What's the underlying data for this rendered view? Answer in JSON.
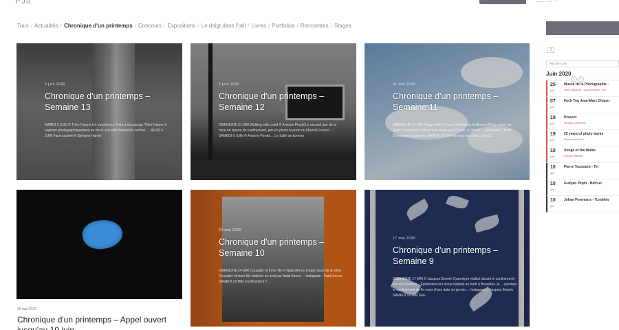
{
  "header": {
    "brand": "PJa",
    "right_text": "……… ∙ ∙"
  },
  "breadcrumb": [
    {
      "label": "Tous",
      "active": false
    },
    {
      "label": "Actualités",
      "active": false
    },
    {
      "label": "Chronique d'un printemps",
      "active": true
    },
    {
      "label": "Concours",
      "active": false
    },
    {
      "label": "Expositions",
      "active": false
    },
    {
      "label": "Le doigt dans l'œil",
      "active": false
    },
    {
      "label": "Livres",
      "active": false
    },
    {
      "label": "Portfolios",
      "active": false
    },
    {
      "label": "Rencontres",
      "active": false
    },
    {
      "label": "Stages",
      "active": false
    }
  ],
  "cards": {
    "c1": {
      "date": "9 juin 2020",
      "title": "Chronique d'un printemps – Semaine 13",
      "excerpt": "MARDI 9 JUIN © Théo Fatone Un travail pour Théo a encourage Théo Fatone à explorer photographiquement sa vie et son état d'esprit de confiné ... JEUDI 4 JUIN Face cachée © Sylvaine Hamel"
    },
    "c2": {
      "date": "2 juin 2020",
      "title": "Chronique d'un printemps – Semaine 12",
      "excerpt": "DIMANCHE 31 MAI Walking with covid © Antoine Pinold Le second jour de la mise en œuvre de confinement, pris en photo la porte du Marché Franco ... SAMEDI 6 JUIN © Antoine Pinold ... Le Salle de bonnes"
    },
    "c3": {
      "date": "31 mai 2020",
      "title": "Chronique d'un printemps – Semaine 11",
      "excerpt": "DIMANCHE 31 MAI A day in life © Jean-Christophe Guillaume Photo prise par Jean-Christophe Guillaume le week-end 12 mai, à Namur ... Instagram : Jean-Christophe Guillaume SAMEDI 30 MAI life was less than 1 me 3..."
    },
    "c4": {
      "date": "25 mai 2020",
      "title": "Chronique d'un printemps – Appel ouvert jusqu'au 19 juin"
    },
    "c5": {
      "date": "24 mai 2020",
      "title": "Chronique d'un printemps – Semaine 10",
      "excerpt": "DIMANCHE 24 MAI Crusader of Inner life © Nabil Annes Image issue de la série Crusader of inner life réalisée en avril par Nabil Annes ... Instagram : Nabil Annes SAMEDI 23 MAI Confinement T..."
    },
    "c6": {
      "date": "17 mai 2020",
      "title": "Chronique d'un printemps – Semaine 9",
      "excerpt": "DIMANCHE 17 MAI © Jacques Bonnie Cyanotype réalisé durant le confinement sur nos camées – Éphémère lors d'une ballade en forêt à Bruxelles Je ... pendant le confinement de fin mars d'une date en janvier ... Instagram : Jacques Bonnie SAMEDI 16 MAI Sea..."
    }
  },
  "sidebar": {
    "mini_label": "1",
    "search_placeholder": "Rechercher",
    "month": "Juin 2020",
    "prev_label": "‹",
    "next_label": "›",
    "events": [
      {
        "day": "25",
        "mon": "juin",
        "title": "Musée de la Photographie -",
        "sub": "René Magritte - Laurent Bilon - Bé",
        "dark": false
      },
      {
        "day": "07",
        "mon": "juin",
        "title": "Fuck You Jean-Marc Chapa -",
        "sub": "",
        "dark": false
      },
      {
        "day": "19",
        "mon": "juin",
        "title": "Present",
        "sub": "Nicolas Castlenov",
        "dark": false
      },
      {
        "day": "19",
        "mon": "juin",
        "title": "25 years of photo works",
        "sub": "Raymond Rosso",
        "dark": false
      },
      {
        "day": "19",
        "mon": "juin",
        "title": "Songs of the Walks",
        "sub": "Pascal Willems",
        "dark": false
      },
      {
        "day": "10",
        "mon": "juin",
        "title": "Pierre Toussaint - Tel",
        "sub": "",
        "dark": true
      },
      {
        "day": "10",
        "mon": "juin",
        "title": "Guilyan Pépin - Beth-el",
        "sub": "",
        "dark": true
      },
      {
        "day": "10",
        "mon": "juin",
        "title": "Johan Peremans - Tumblew",
        "sub": "",
        "dark": true
      }
    ]
  }
}
